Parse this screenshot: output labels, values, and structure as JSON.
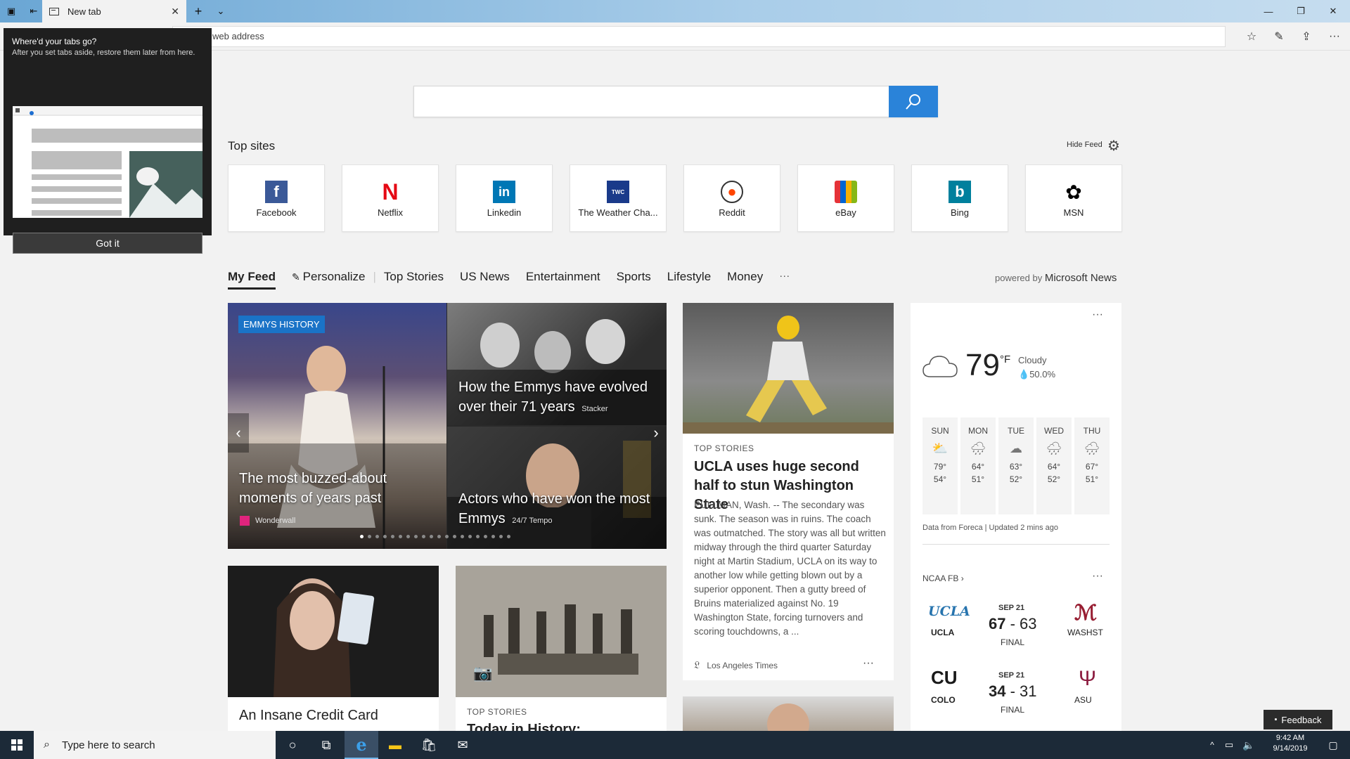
{
  "browser": {
    "tab_title": "New tab",
    "address_placeholder": "web address"
  },
  "flyout": {
    "title": "Where'd your tabs go?",
    "body": "After you set tabs aside, restore them later from here.",
    "button": "Got it"
  },
  "top_sites": {
    "title": "Top sites",
    "hide_feed": "Hide Feed",
    "tiles": [
      {
        "label": "Facebook",
        "icon": "facebook-icon",
        "color": "#3b5998",
        "glyph": "f"
      },
      {
        "label": "Netflix",
        "icon": "netflix-icon",
        "color": "#e50914",
        "glyph": "N"
      },
      {
        "label": "Linkedin",
        "icon": "linkedin-icon",
        "color": "#0077b5",
        "glyph": "in"
      },
      {
        "label": "The Weather Cha...",
        "icon": "weather-channel-icon",
        "color": "#1a3a8a",
        "glyph": "TWC"
      },
      {
        "label": "Reddit",
        "icon": "reddit-icon",
        "color": "#ff4500",
        "glyph": "r"
      },
      {
        "label": "eBay",
        "icon": "ebay-icon",
        "color": "#333333",
        "glyph": "e"
      },
      {
        "label": "Bing",
        "icon": "bing-icon",
        "color": "#00809d",
        "glyph": "b"
      },
      {
        "label": "MSN",
        "icon": "msn-icon",
        "color": "#000000",
        "glyph": "✿"
      }
    ]
  },
  "feed_nav": {
    "items": [
      "My Feed",
      "Personalize",
      "Top Stories",
      "US News",
      "Entertainment",
      "Sports",
      "Lifestyle",
      "Money",
      "···"
    ],
    "powered_prefix": "powered by",
    "powered_brand": "Microsoft News"
  },
  "hero": {
    "badge": "EMMYS HISTORY",
    "main_title": "The most buzzed-about moments of years past",
    "main_source": "Wonderwall",
    "side1_title": "How the Emmys have evolved over their 71 years",
    "side1_source": "Stacker",
    "side2_title": "Actors who have won the most Emmys",
    "side2_source": "24/7 Tempo"
  },
  "story": {
    "kicker": "TOP STORIES",
    "title": "UCLA uses huge second half to stun Washington State",
    "body": "PULLMAN, Wash. -- The secondary was sunk. The season was in ruins. The coach was outmatched. The story was all but written midway through the third quarter Saturday night at Martin Stadium, UCLA on its way to another low while getting blown out by a superior opponent. Then a gutty breed of Bruins materialized against No. 19 Washington State, forcing turnovers and scoring touchdowns, a ...",
    "source": "Los Angeles Times",
    "more": "···"
  },
  "weather": {
    "more": "···",
    "temp": "79",
    "unit": "°F",
    "condition": "Cloudy",
    "precip": "50.0%",
    "days": [
      {
        "name": "SUN",
        "hi": "79°",
        "lo": "54°",
        "icon": "partly-sunny-icon"
      },
      {
        "name": "MON",
        "hi": "64°",
        "lo": "51°",
        "icon": "rain-icon"
      },
      {
        "name": "TUE",
        "hi": "63°",
        "lo": "52°",
        "icon": "cloudy-icon"
      },
      {
        "name": "WED",
        "hi": "64°",
        "lo": "52°",
        "icon": "rain-icon"
      },
      {
        "name": "THU",
        "hi": "67°",
        "lo": "51°",
        "icon": "rain-icon"
      }
    ],
    "footer": "Data from Foreca | Updated 2 mins ago"
  },
  "ncaa": {
    "title": "NCAA FB",
    "more": "···",
    "games": [
      {
        "date": "SEP 21",
        "home": "UCLA",
        "away": "WASHST",
        "home_score": "67",
        "away_score": "63",
        "status": "FINAL"
      },
      {
        "date": "SEP 21",
        "home": "COLO",
        "away": "ASU",
        "home_score": "34",
        "away_score": "31",
        "status": "FINAL"
      }
    ]
  },
  "lower": {
    "card1_title": "An Insane Credit Card",
    "card2_kicker": "TOP STORIES",
    "card2_title": "Today in History:"
  },
  "feedback": "Feedback",
  "taskbar": {
    "search_placeholder": "Type here to search",
    "time": "9:42 AM",
    "date": "9/14/2019"
  }
}
